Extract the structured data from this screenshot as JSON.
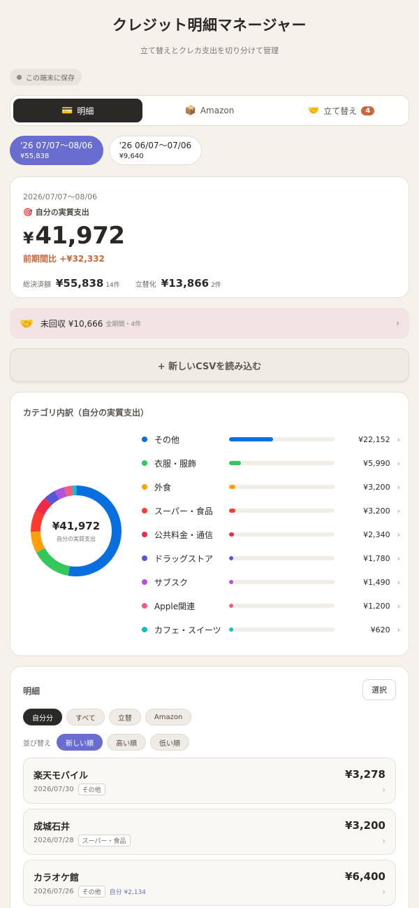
{
  "header": {
    "title": "クレジット明細マネージャー",
    "subtitle": "立て替えとクレカ支出を切り分けて管理",
    "storage": "この端末に保存"
  },
  "tabs": [
    {
      "icon": "💳",
      "label": "明細"
    },
    {
      "icon": "📦",
      "label": "Amazon"
    },
    {
      "icon": "🤝",
      "label": "立て替え",
      "badge": "4"
    }
  ],
  "periods": [
    {
      "range": "'26 07/07〜08/06",
      "amount": "¥55,838"
    },
    {
      "range": "'26 06/07〜07/06",
      "amount": "¥9,640"
    }
  ],
  "summary": {
    "range": "2026/07/07〜08/06",
    "label_icon": "🎯",
    "label": "自分の実質支出",
    "yen": "¥",
    "amount": "41,972",
    "diff": "前期間比 +¥32,332",
    "total_label": "総決済額",
    "total_value": "¥55,838",
    "total_count": "14件",
    "adv_label": "立替化",
    "adv_value": "¥13,866",
    "adv_count": "2件"
  },
  "unpaid": {
    "icon": "🤝",
    "text": "未回収 ¥10,666",
    "sub": "全期間・4件",
    "chevron": "›"
  },
  "csv_button": "+ 新しいCSVを読み込む",
  "category": {
    "title": "カテゴリ内訳（自分の実質支出）",
    "center_value": "¥41,972",
    "center_label": "自分の実質支出",
    "chevron": "›",
    "items": [
      {
        "name": "その他",
        "amount": "¥22,152",
        "value": 22152,
        "color": "#0a6fde"
      },
      {
        "name": "衣服・服飾",
        "amount": "¥5,990",
        "value": 5990,
        "color": "#34c759"
      },
      {
        "name": "外食",
        "amount": "¥3,200",
        "value": 3200,
        "color": "#ff9f0a"
      },
      {
        "name": "スーパー・食品",
        "amount": "¥3,200",
        "value": 3200,
        "color": "#ff3b30"
      },
      {
        "name": "公共料金・通信",
        "amount": "¥2,340",
        "value": 2340,
        "color": "#f0284a"
      },
      {
        "name": "ドラッグストア",
        "amount": "¥1,780",
        "value": 1780,
        "color": "#5856d6"
      },
      {
        "name": "サブスク",
        "amount": "¥1,490",
        "value": 1490,
        "color": "#af52de"
      },
      {
        "name": "Apple関連",
        "amount": "¥1,200",
        "value": 1200,
        "color": "#f25c7e"
      },
      {
        "name": "カフェ・スイーツ",
        "amount": "¥620",
        "value": 620,
        "color": "#14bfc2"
      }
    ]
  },
  "transactions": {
    "title": "明細",
    "select_label": "選択",
    "filters": [
      "自分分",
      "すべて",
      "立替",
      "Amazon"
    ],
    "sort_label": "並び替え",
    "sorts": [
      "新しい順",
      "高い順",
      "低い順"
    ],
    "chevron": "›",
    "items": [
      {
        "merchant": "楽天モバイル",
        "date": "2026/07/30",
        "category": "その他",
        "amount": "¥3,278",
        "own": ""
      },
      {
        "merchant": "成城石井",
        "date": "2026/07/28",
        "category": "スーパー・食品",
        "amount": "¥3,200",
        "own": ""
      },
      {
        "merchant": "カラオケ館",
        "date": "2026/07/26",
        "category": "その他",
        "amount": "¥6,400",
        "own": "自分 ¥2,134"
      }
    ]
  }
}
